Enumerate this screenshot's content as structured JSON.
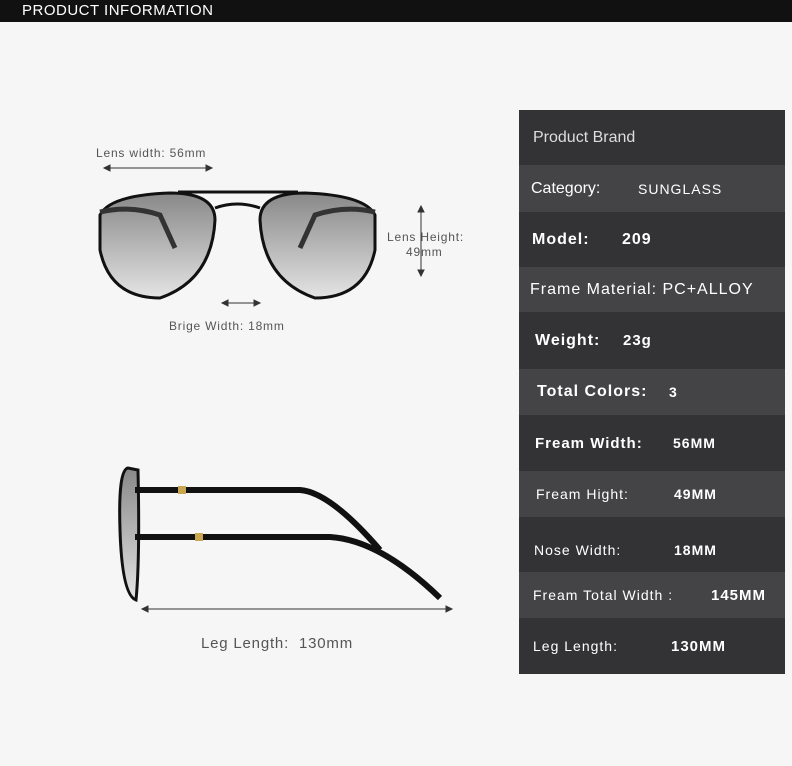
{
  "header": {
    "title": "PRODUCT INFORMATION"
  },
  "diagram": {
    "lens_width": "Lens width:   56mm",
    "lens_height_label": "Lens Height:",
    "lens_height_value": "49mm",
    "bridge_width": "Brige Width: 18mm",
    "leg_length": "Leg Length:  130mm"
  },
  "specs": [
    {
      "label": "Product Brand",
      "value": ""
    },
    {
      "label": "Category:",
      "value": "SUNGLASS"
    },
    {
      "label": "Model:",
      "value": "209"
    },
    {
      "label": "Frame Material:",
      "value": "PC+ALLOY"
    },
    {
      "label": "Weight:",
      "value": "23g"
    },
    {
      "label": "Total Colors:",
      "value": "3"
    },
    {
      "label": "Fream Width:",
      "value": "56MM"
    },
    {
      "label": "Fream Hight:",
      "value": "49MM"
    },
    {
      "label": "Nose Width:",
      "value": "18MM"
    },
    {
      "label": "Fream Total Width :",
      "value": "145MM"
    },
    {
      "label": "Leg Length:",
      "value": "130MM"
    }
  ],
  "colors": {
    "dark_row": "#333336",
    "light_row": "#444447"
  }
}
